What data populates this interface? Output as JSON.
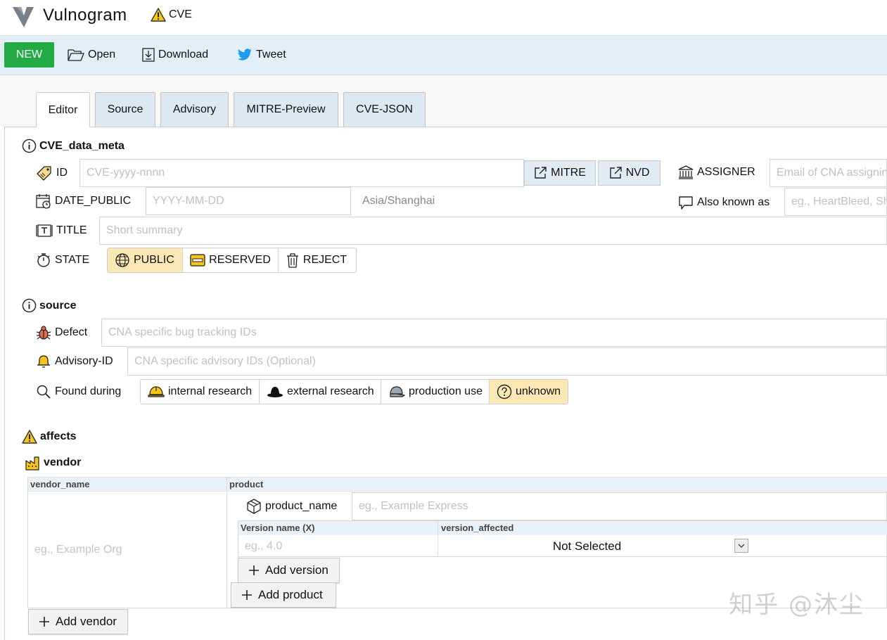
{
  "header": {
    "app_title": "Vulnogram",
    "badge_label": "CVE"
  },
  "toolbar": {
    "new_label": "NEW",
    "open_label": "Open",
    "download_label": "Download",
    "tweet_label": "Tweet"
  },
  "tabs": [
    {
      "label": "Editor",
      "active": true
    },
    {
      "label": "Source"
    },
    {
      "label": "Advisory"
    },
    {
      "label": "MITRE-Preview"
    },
    {
      "label": "CVE-JSON"
    }
  ],
  "cve_data_meta": {
    "title": "CVE_data_meta",
    "id_label": "ID",
    "id_placeholder": "CVE-yyyy-nnnn",
    "mitre_label": "MITRE",
    "nvd_label": "NVD",
    "assigner_label": "ASSIGNER",
    "assigner_placeholder": "Email of CNA assigning this ID",
    "date_label": "DATE_PUBLIC",
    "date_placeholder": "YYYY-MM-DD",
    "timezone": "Asia/Shanghai",
    "aka_label": "Also known as",
    "aka_placeholder": "eg., HeartBleed, Shellshock",
    "title_label": "TITLE",
    "title_placeholder": "Short summary",
    "state_label": "STATE",
    "state_options": [
      "PUBLIC",
      "RESERVED",
      "REJECT"
    ],
    "state_selected": "PUBLIC"
  },
  "source": {
    "title": "source",
    "defect_label": "Defect",
    "defect_placeholder": "CNA specific bug tracking IDs",
    "advisory_label": "Advisory-ID",
    "advisory_placeholder": "CNA specific advisory IDs (Optional)",
    "found_label": "Found during",
    "found_options": [
      "internal research",
      "external research",
      "production use",
      "unknown"
    ],
    "found_selected": "unknown"
  },
  "affects": {
    "title": "affects",
    "vendor_title": "vendor",
    "col_vendor_name": "vendor_name",
    "col_product": "product",
    "vendor_placeholder": "eg., Example Org",
    "product_name_label": "product_name",
    "product_name_placeholder": "eg., Example Express",
    "col_version_name": "Version name (X)",
    "col_version_affected": "version_affected",
    "version_placeholder": "eg., 4.0",
    "version_affected_value": "Not Selected",
    "add_version": "Add version",
    "add_product": "Add product",
    "add_vendor": "Add vendor"
  },
  "watermark": "知乎 @沐尘",
  "colors": {
    "new_button": "#22aa44",
    "toolbar_bg": "#e3eef7",
    "selected_option": "#fbe8b5",
    "warning": "#f5c518"
  }
}
